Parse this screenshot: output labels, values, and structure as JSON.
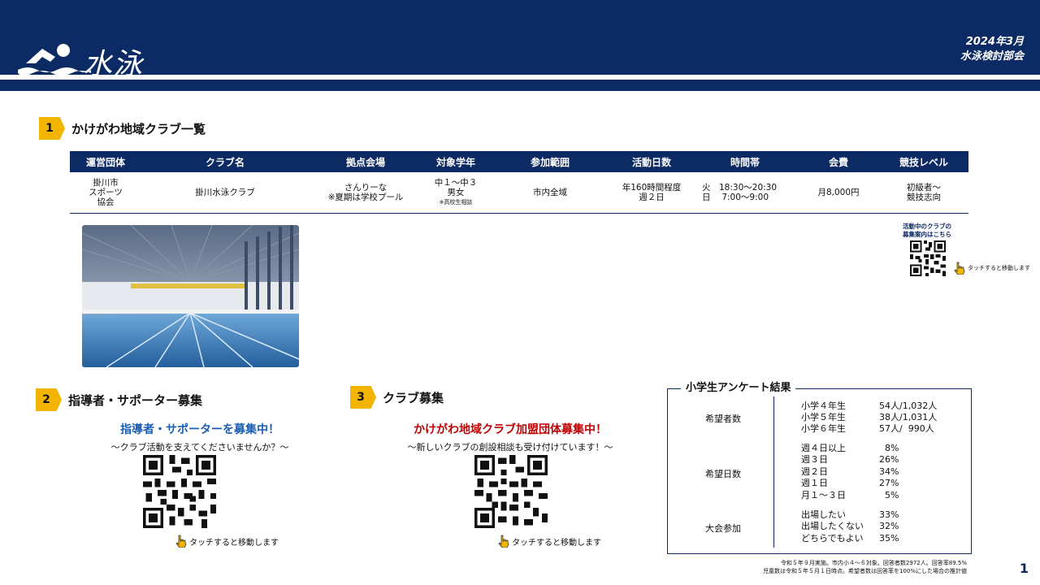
{
  "header": {
    "logo_text": "水泳",
    "date": "2024年3月",
    "org": "水泳検討部会",
    "logo_icon": "swimmer-icon",
    "color": "#0c2a63"
  },
  "section1": {
    "num": "1",
    "title": "かけがわ地域クラブ一覧",
    "table": {
      "headers": [
        "運営団体",
        "クラブ名",
        "拠点会場",
        "対象学年",
        "参加範囲",
        "活動日数",
        "時間帯",
        "会費",
        "競技レベル"
      ],
      "row": {
        "org": [
          "掛川市",
          "スポーツ",
          "協会"
        ],
        "club": "掛川水泳クラブ",
        "venue": [
          "さんりーな",
          "※夏期は学校プール"
        ],
        "grade": [
          "中１～中３",
          "男女",
          "※高校生相談"
        ],
        "range": "市内全域",
        "days": [
          "年160時間程度",
          "週２日"
        ],
        "time": [
          "火　18:30～20:30",
          "日　 7:00～9:00"
        ],
        "fee": "月8,000円",
        "level": [
          "初級者～",
          "競技志向"
        ]
      }
    },
    "qr_caption": [
      "活動中のクラブの",
      "募集案内はこちら"
    ],
    "touch": "タッチすると移動します"
  },
  "section2": {
    "num": "2",
    "title": "指導者・サポーター募集",
    "headline": "指導者・サポーターを募集中！",
    "sub": "～クラブ活動を支えてくださいませんか？～",
    "touch": "タッチすると移動します",
    "accent": "#1a5fb4"
  },
  "section3": {
    "num": "3",
    "title": "クラブ募集",
    "headline": "かけがわ地域クラブ加盟団体募集中！",
    "sub": "～新しいクラブの創設相談も受け付けています！～",
    "touch": "タッチすると移動します",
    "accent": "#c00000"
  },
  "survey": {
    "title": "小学生アンケート結果",
    "groups": [
      {
        "label": "希望者数",
        "rows": [
          [
            "小学４年生",
            "54人/1,032人"
          ],
          [
            "小学５年生",
            "38人/1,031人"
          ],
          [
            "小学６年生",
            "57人/  990人"
          ]
        ]
      },
      {
        "label": "希望日数",
        "rows": [
          [
            "週４日以上",
            "  8%"
          ],
          [
            "週３日",
            "26%"
          ],
          [
            "週２日",
            "34%"
          ],
          [
            "週１日",
            "27%"
          ],
          [
            "月１～３日",
            "  5%"
          ]
        ]
      },
      {
        "label": "大会参加",
        "rows": [
          [
            "出場したい",
            "33%"
          ],
          [
            "出場したくない",
            "32%"
          ],
          [
            "どちらでもよい",
            "35%"
          ]
        ]
      }
    ],
    "footnote": [
      "令和５年９月実施。市内小４～６対象。回答者数2972人。回答率89.5%",
      "児童数は令和５年５月１日時点。希望者数は回答率を100%にした場合の推計値"
    ]
  },
  "page_number": "1"
}
